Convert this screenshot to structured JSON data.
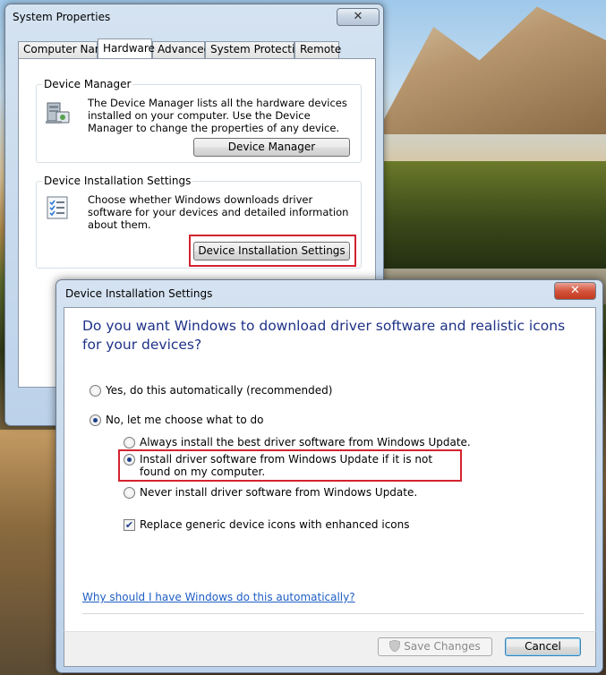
{
  "system_properties": {
    "title": "System Properties",
    "close_glyph": "✕",
    "tabs": [
      {
        "label": "Computer Name",
        "active": false
      },
      {
        "label": "Hardware",
        "active": true
      },
      {
        "label": "Advanced",
        "active": false
      },
      {
        "label": "System Protection",
        "active": false
      },
      {
        "label": "Remote",
        "active": false
      }
    ],
    "device_manager": {
      "legend": "Device Manager",
      "icon": "device-manager-computer-icon",
      "description": "The Device Manager lists all the hardware devices installed on your computer. Use the Device Manager to change the properties of any device.",
      "button_label": "Device Manager"
    },
    "device_installation": {
      "legend": "Device Installation Settings",
      "icon": "checklist-icon",
      "description": "Choose whether Windows downloads driver software for your devices and detailed information about them.",
      "button_label": "Device Installation Settings"
    }
  },
  "dialog": {
    "title": "Device Installation Settings",
    "close_glyph": "✕",
    "question": "Do you want Windows to download driver software and realistic icons for your devices?",
    "options": {
      "yes_auto": {
        "label": "Yes, do this automatically (recommended)",
        "checked": false
      },
      "no_choose": {
        "label": "No, let me choose what to do",
        "checked": true
      }
    },
    "sub_options": {
      "always_install": {
        "label": "Always install the best driver software from Windows Update.",
        "checked": false
      },
      "install_if_not_found": {
        "label": "Install driver software from Windows Update if it is not found on my computer.",
        "checked": true
      },
      "never_install": {
        "label": "Never install driver software from Windows Update.",
        "checked": false
      }
    },
    "replace_icons": {
      "label": "Replace generic device icons with enhanced icons",
      "checked": true,
      "glyph": "✔"
    },
    "help_link": "Why should I have Windows do this automatically?",
    "save_button": "Save Changes",
    "cancel_button": "Cancel"
  },
  "colors": {
    "heading_blue": "#1e3287",
    "link_blue": "#1e5ec4",
    "highlight_red": "#d3232f"
  }
}
